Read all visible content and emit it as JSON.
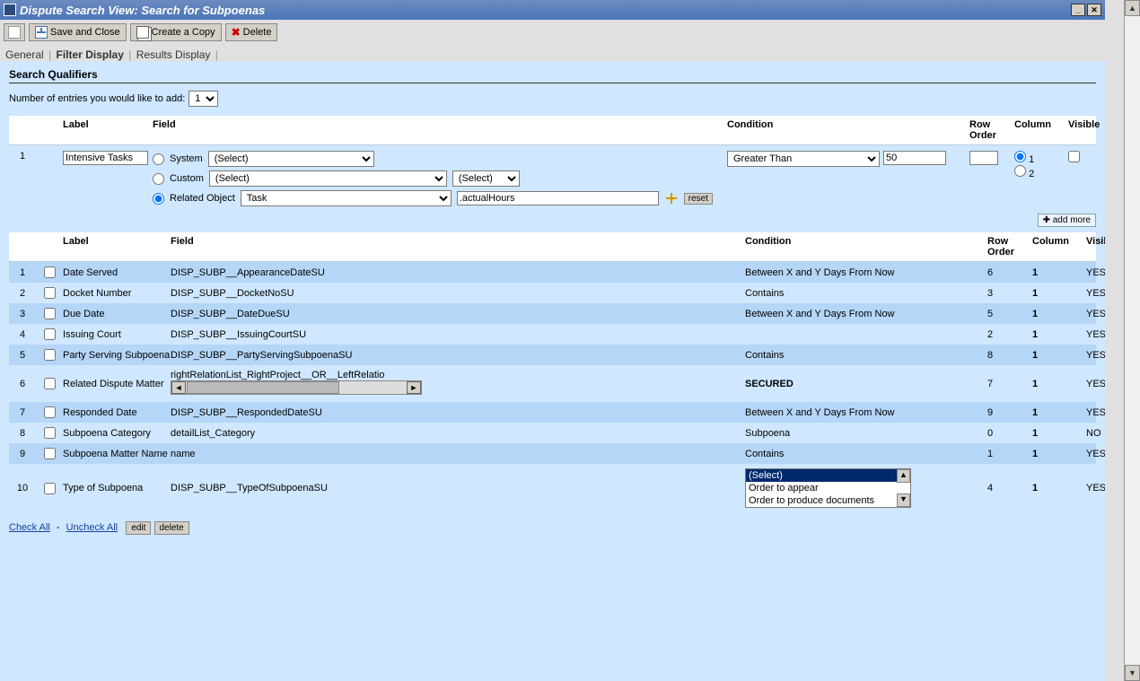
{
  "window_title": "Dispute Search View: Search for Subpoenas",
  "toolbar": {
    "save_close": "Save and Close",
    "create_copy": "Create a Copy",
    "delete": "Delete"
  },
  "tabs": {
    "general": "General",
    "filter": "Filter Display",
    "results": "Results Display"
  },
  "section": {
    "title": "Search Qualifiers",
    "add_label": "Number of entries you would like to add:",
    "add_count": "1"
  },
  "headers": {
    "label": "Label",
    "field": "Field",
    "condition": "Condition",
    "row_order": "Row Order",
    "column": "Column",
    "visible": "Visible"
  },
  "qualifier": {
    "num": "1",
    "label_value": "Intensive Tasks",
    "system": "System",
    "system_select": "(Select)",
    "custom": "Custom",
    "custom_select1": "(Select)",
    "custom_select2": "(Select)",
    "related": "Related Object",
    "related_select": "Task",
    "related_attr": ".actualHours",
    "reset": "reset",
    "cond_op": "Greater Than",
    "cond_val": "50",
    "col1": "1",
    "col2": "2"
  },
  "addmore": "add more",
  "existing": [
    {
      "num": "1",
      "label": "Date Served",
      "field": "DISP_SUBP__AppearanceDateSU",
      "condition": "Between X and Y Days From Now",
      "row": "6",
      "col": "1",
      "visible": "YES"
    },
    {
      "num": "2",
      "label": "Docket Number",
      "field": "DISP_SUBP__DocketNoSU",
      "condition": "Contains",
      "row": "3",
      "col": "1",
      "visible": "YES"
    },
    {
      "num": "3",
      "label": "Due Date",
      "field": "DISP_SUBP__DateDueSU",
      "condition": "Between X and Y Days From Now",
      "row": "5",
      "col": "1",
      "visible": "YES"
    },
    {
      "num": "4",
      "label": "Issuing Court",
      "field": "DISP_SUBP__IssuingCourtSU",
      "condition": "",
      "row": "2",
      "col": "1",
      "visible": "YES"
    },
    {
      "num": "5",
      "label": "Party Serving Subpoena",
      "field": "DISP_SUBP__PartyServingSubpoenaSU",
      "condition": "Contains",
      "row": "8",
      "col": "1",
      "visible": "YES"
    },
    {
      "num": "6",
      "label": "Related Dispute Matter",
      "field": "rightRelationList_RightProject__OR__LeftRelatio",
      "condition": "SECURED",
      "row": "7",
      "col": "1",
      "visible": "YES",
      "has_scroll": true,
      "secured": true
    },
    {
      "num": "7",
      "label": "Responded Date",
      "field": "DISP_SUBP__RespondedDateSU",
      "condition": "Between X and Y Days From Now",
      "row": "9",
      "col": "1",
      "visible": "YES"
    },
    {
      "num": "8",
      "label": "Subpoena Category",
      "field": "detailList_Category",
      "condition": "Subpoena",
      "row": "0",
      "col": "1",
      "visible": "NO"
    },
    {
      "num": "9",
      "label": "Subpoena Matter Name",
      "field": "name",
      "condition": "Contains",
      "row": "1",
      "col": "1",
      "visible": "YES"
    },
    {
      "num": "10",
      "label": "Type of Subpoena",
      "field": "DISP_SUBP__TypeOfSubpoenaSU",
      "condition": "",
      "row": "4",
      "col": "1",
      "visible": "YES",
      "has_listbox": true
    }
  ],
  "listbox": {
    "sel": "(Select)",
    "opt1": "Order to appear",
    "opt2": "Order to produce documents"
  },
  "foot": {
    "check_all": "Check All",
    "uncheck_all": "Uncheck All",
    "edit": "edit",
    "delete": "delete"
  }
}
